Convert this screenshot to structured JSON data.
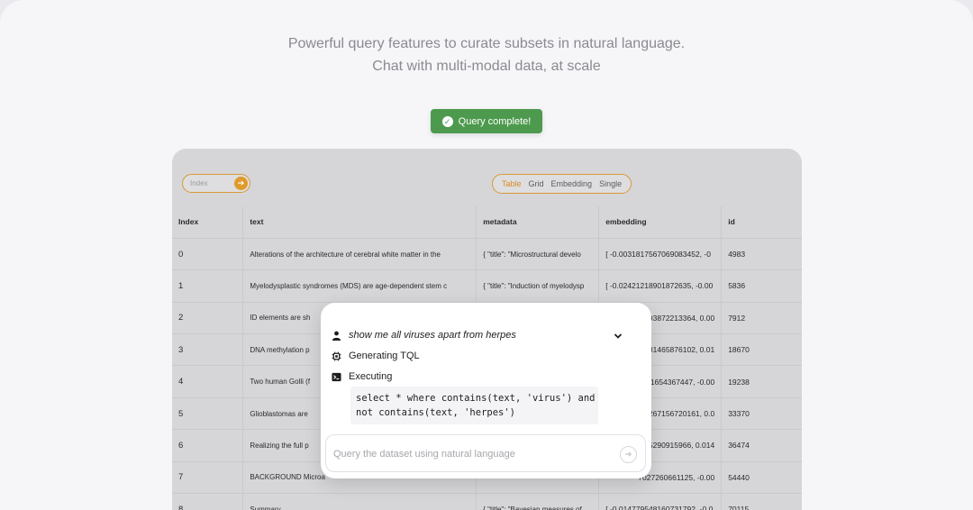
{
  "headline": {
    "line1": "Powerful query features to curate subsets in natural language.",
    "line2": "Chat with multi-modal data, at scale"
  },
  "toast": {
    "label": "Query complete!",
    "color": "#4d9a4e"
  },
  "toolbar": {
    "index_placeholder": "Index",
    "views": [
      "Table",
      "Grid",
      "Embedding",
      "Single"
    ],
    "active_view": "Table",
    "accent": "#e09a2a"
  },
  "table": {
    "columns": [
      "Index",
      "text",
      "metadata",
      "embedding",
      "id"
    ],
    "rows": [
      [
        "0",
        "Alterations of the architecture of cerebral white matter in the",
        "{ \"title\": \"Microstructural develo",
        "[ -0.0031817567069083452, -0",
        "4983"
      ],
      [
        "1",
        "Myelodysplastic syndromes (MDS) are age-dependent stem c",
        "{ \"title\": \"Induction of myelodysp",
        "[ -0.02421218901872635, -0.00",
        "5836"
      ],
      [
        "2",
        "ID elements are sh",
        "",
        "93872213364, 0.00",
        "7912"
      ],
      [
        "3",
        "DNA methylation p",
        "",
        "81465876102, 0.01",
        "18670"
      ],
      [
        "4",
        "Two human Golli (f",
        "",
        "1654367447, -0.00",
        "19238"
      ],
      [
        "5",
        "Glioblastomas are",
        "",
        "267156720161, 0.0",
        "33370"
      ],
      [
        "6",
        "Realizing the full p",
        "",
        "5290915966, 0.014",
        "36474"
      ],
      [
        "7",
        "BACKGROUND Microa",
        "",
        "7027260661125, -0.00",
        "54440"
      ],
      [
        "8",
        "Summary",
        "{ \"title\": \"Bayesian measures of",
        "[ -0.014779548160731792, -0.0",
        "70115"
      ]
    ]
  },
  "chat": {
    "prompt": "show me all viruses apart from herpes",
    "step1": "Generating TQL",
    "step2": "Executing",
    "code": "select * where contains(text, 'virus') and\nnot contains(text, 'herpes')",
    "input_placeholder": "Query the dataset using natural language",
    "icons": {
      "user": "user-icon",
      "chip": "chip-icon",
      "terminal": "terminal-icon",
      "chevron": "chevron-down-icon",
      "send": "arrow-right-icon"
    }
  }
}
